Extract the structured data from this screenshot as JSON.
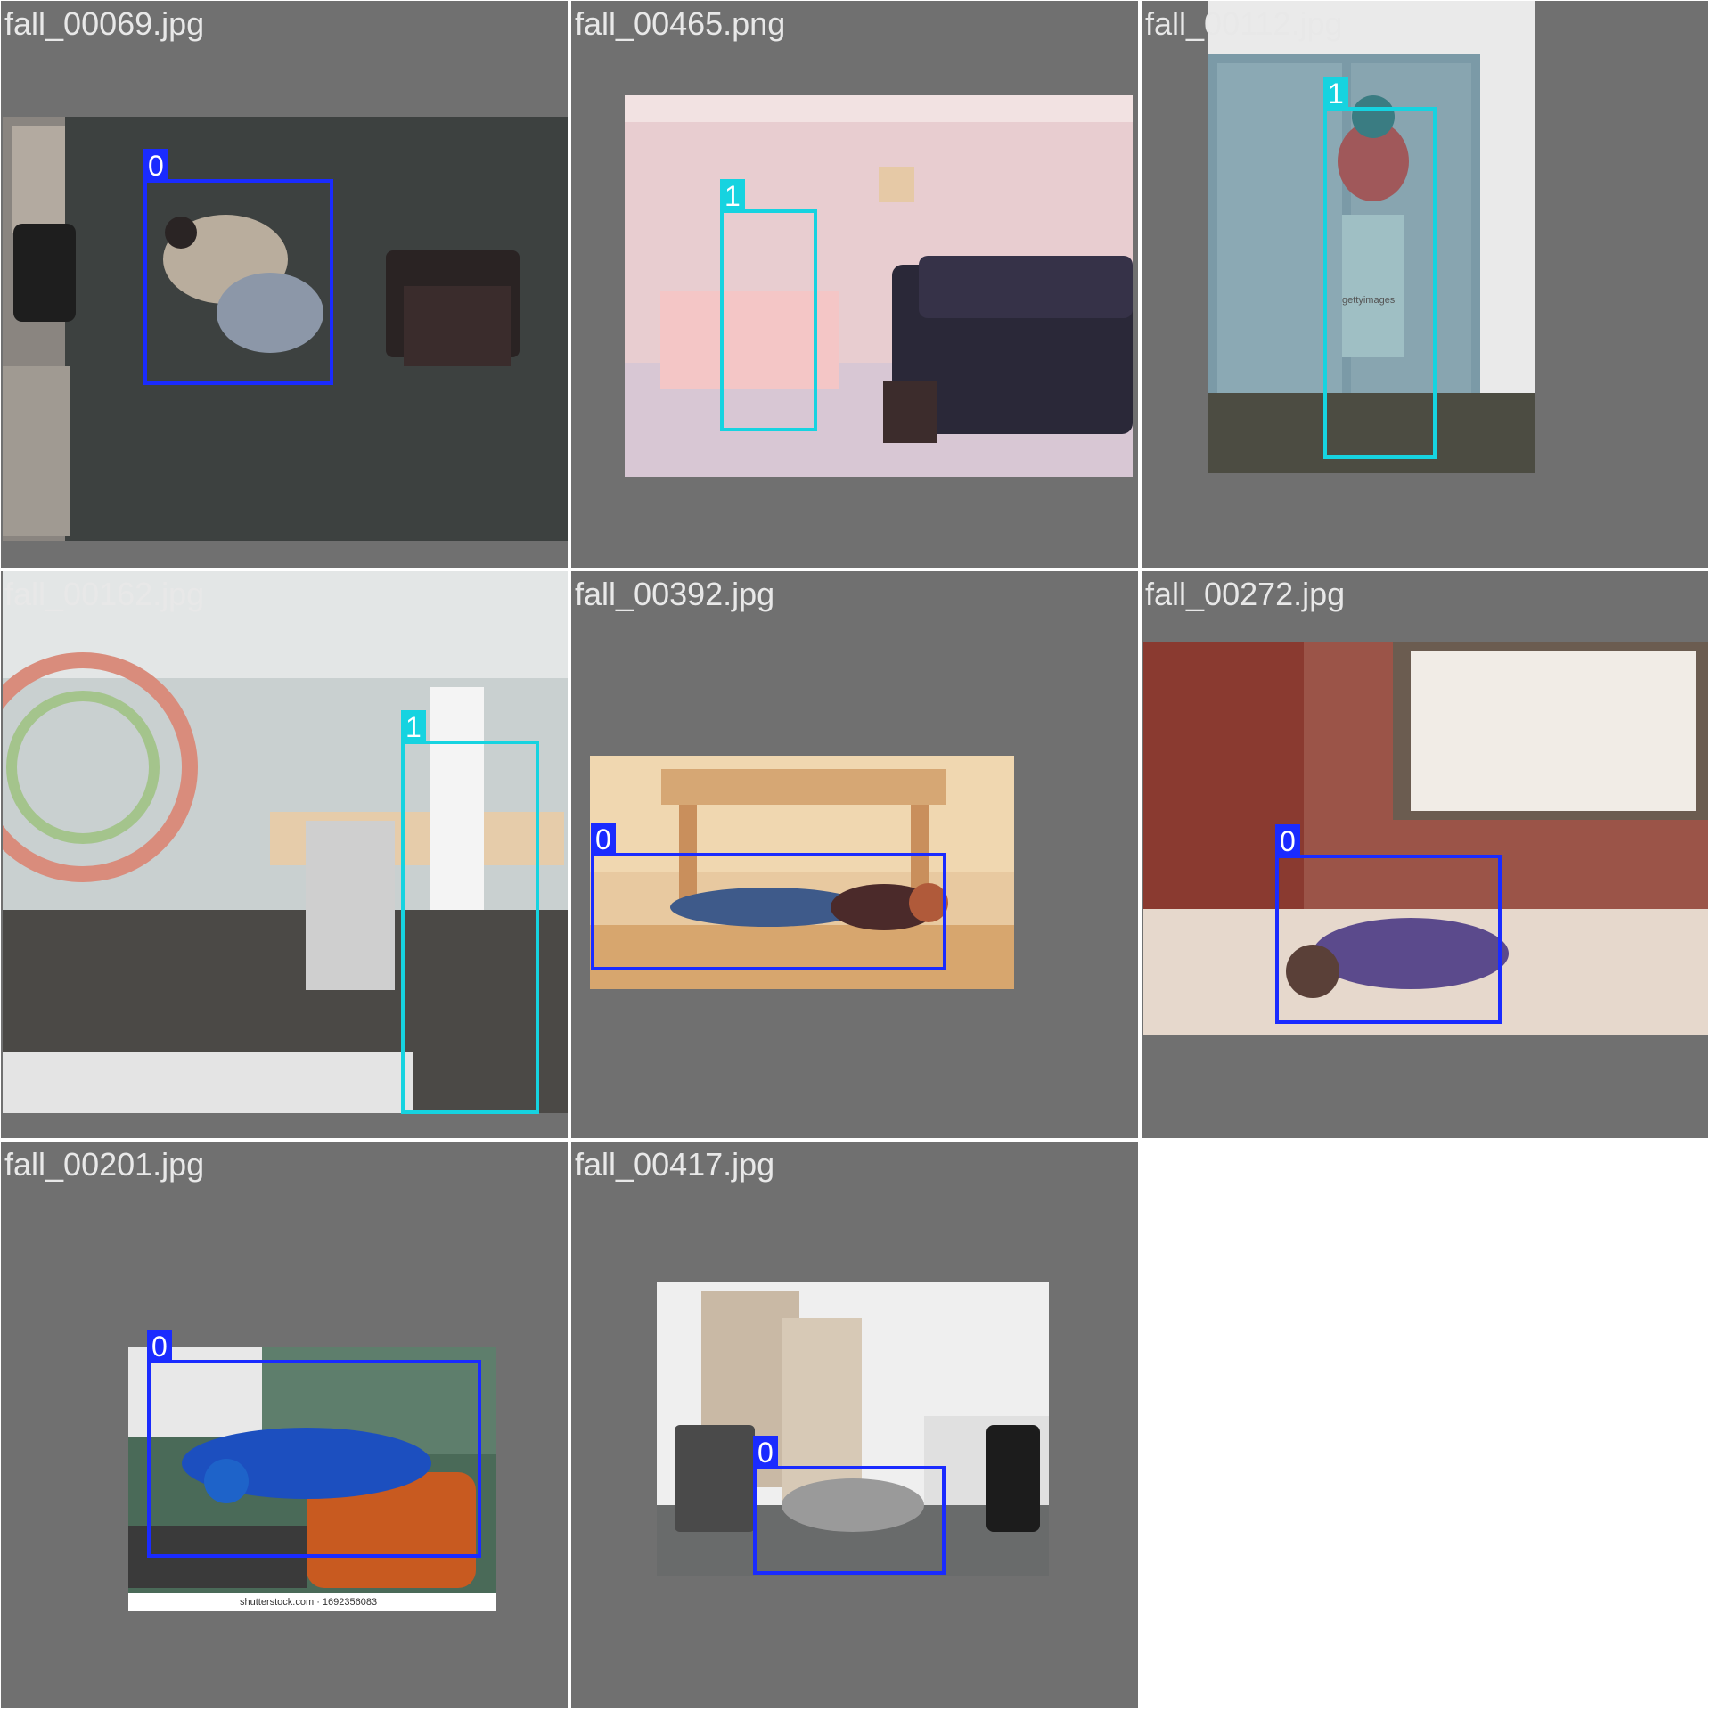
{
  "colors": {
    "tile_background": "#707070",
    "label_text": "#e8e8e8",
    "class_colors": {
      "0": "#1a2bff",
      "1": "#16d3e0"
    }
  },
  "tiles": [
    {
      "filename": "fall_00069.jpg",
      "boxes": [
        {
          "class_label": "0"
        }
      ]
    },
    {
      "filename": "fall_00465.png",
      "boxes": [
        {
          "class_label": "1"
        }
      ]
    },
    {
      "filename": "fall_00112.jpg",
      "boxes": [
        {
          "class_label": "1"
        }
      ],
      "watermark": "gettyimages"
    },
    {
      "filename": "fall_00162.jpg",
      "boxes": [
        {
          "class_label": "1"
        }
      ]
    },
    {
      "filename": "fall_00392.jpg",
      "boxes": [
        {
          "class_label": "0"
        }
      ]
    },
    {
      "filename": "fall_00272.jpg",
      "boxes": [
        {
          "class_label": "0"
        }
      ]
    },
    {
      "filename": "fall_00201.jpg",
      "boxes": [
        {
          "class_label": "0"
        }
      ],
      "watermark": "shutterstock.com · 1692356083"
    },
    {
      "filename": "fall_00417.jpg",
      "boxes": [
        {
          "class_label": "0"
        }
      ]
    }
  ]
}
